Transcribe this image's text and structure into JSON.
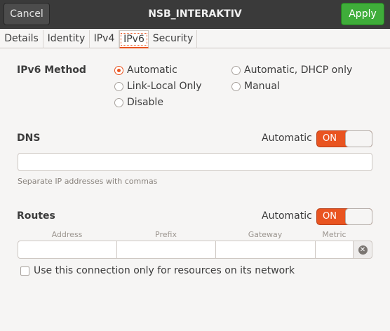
{
  "header": {
    "cancel_label": "Cancel",
    "title": "NSB_INTERAKTIV",
    "apply_label": "Apply"
  },
  "tabs": [
    {
      "label": "Details",
      "active": false
    },
    {
      "label": "Identity",
      "active": false
    },
    {
      "label": "IPv4",
      "active": false
    },
    {
      "label": "IPv6",
      "active": true
    },
    {
      "label": "Security",
      "active": false
    }
  ],
  "ipv6_method": {
    "label": "IPv6 Method",
    "selected": "Automatic",
    "options": [
      "Automatic",
      "Automatic, DHCP only",
      "Link-Local Only",
      "Manual",
      "Disable"
    ]
  },
  "dns": {
    "label": "DNS",
    "automatic_label": "Automatic",
    "switch_label": "ON",
    "value": "",
    "hint": "Separate IP addresses with commas"
  },
  "routes": {
    "label": "Routes",
    "automatic_label": "Automatic",
    "switch_label": "ON",
    "columns": [
      "Address",
      "Prefix",
      "Gateway",
      "Metric"
    ],
    "clear_icon": "clear-circle-icon"
  },
  "network_only": {
    "label": "Use this connection only for resources on its network",
    "checked": false
  },
  "colors": {
    "accent": "#e95420",
    "apply": "#3fad3a",
    "headerbar": "#3a3a3a"
  }
}
